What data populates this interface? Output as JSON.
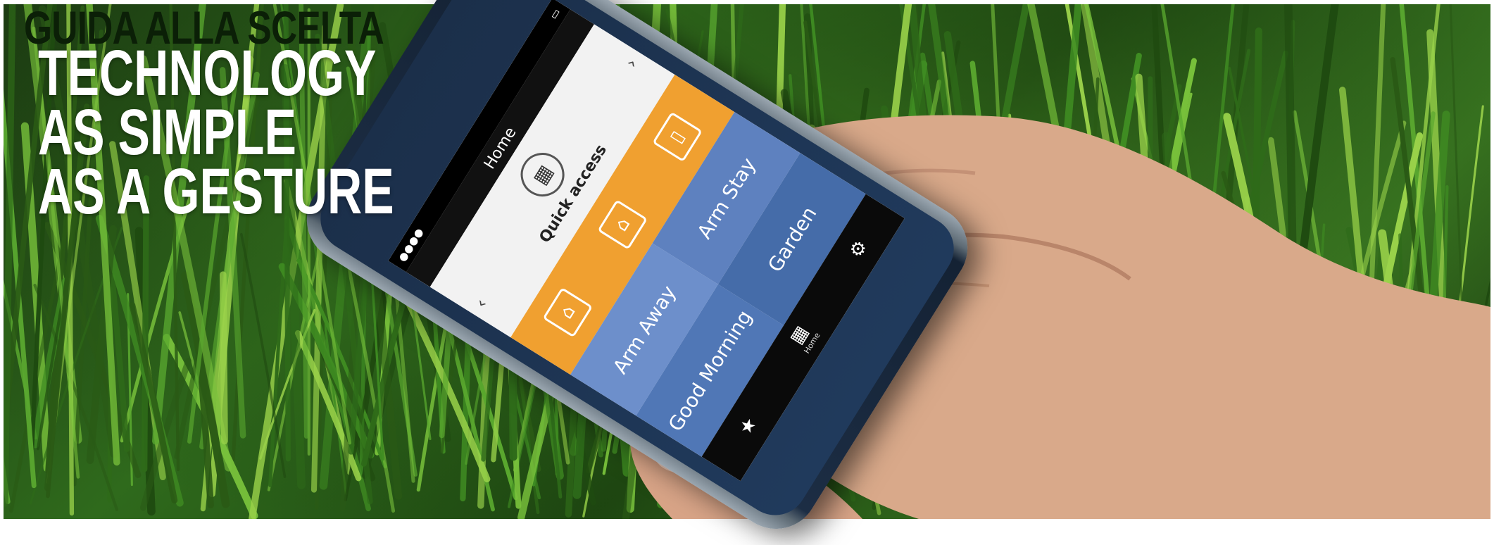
{
  "headline": {
    "eyebrow": "GUIDA ALLA SCELTA",
    "title_lines": [
      "TECHNOLOGY",
      "AS SIMPLE",
      "AS A GESTURE"
    ]
  },
  "phone_screen": {
    "nav_title": "Home",
    "quick_access_label": "Quick access",
    "scenes": {
      "arm_away": "Arm Away",
      "arm_stay": "Arm Stay",
      "good_morning": "Good Morning",
      "garden": "Garden",
      "home": "Home"
    }
  },
  "colors": {
    "grass_dark": "#1c3b12",
    "grass_light": "#3b7a22",
    "orange_tile": "#f0a030",
    "blue_tile": "#5e81bf",
    "title_white": "#ffffff",
    "eyebrow_dark": "#0b1f07"
  },
  "icons": {
    "quick": "keypad-icon",
    "star": "star-icon",
    "gear": "gear-icon"
  }
}
